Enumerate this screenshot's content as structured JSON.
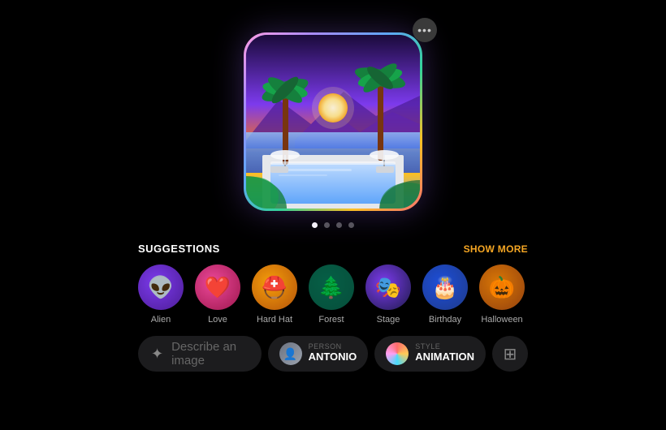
{
  "header": {
    "more_button_label": "•••"
  },
  "image": {
    "alt": "Tropical pool at sunset with palm trees"
  },
  "pagination": {
    "dots": [
      {
        "active": true
      },
      {
        "active": false
      },
      {
        "active": false
      },
      {
        "active": false
      }
    ]
  },
  "suggestions": {
    "title": "SUGGESTIONS",
    "show_more": "SHOW MORE",
    "items": [
      {
        "label": "Alien",
        "emoji": "👽",
        "bg_class": "alien-bg"
      },
      {
        "label": "Love",
        "emoji": "❤️",
        "bg_class": "love-bg"
      },
      {
        "label": "Hard Hat",
        "emoji": "⛑️",
        "bg_class": "hardhat-bg"
      },
      {
        "label": "Forest",
        "emoji": "🌲",
        "bg_class": "forest-bg"
      },
      {
        "label": "Stage",
        "emoji": "🎭",
        "bg_class": "stage-bg"
      },
      {
        "label": "Birthday",
        "emoji": "🎂",
        "bg_class": "birthday-bg"
      },
      {
        "label": "Halloween",
        "emoji": "🎃",
        "bg_class": "halloween-bg"
      }
    ]
  },
  "bottom_bar": {
    "describe_placeholder": "Describe an image",
    "person_label": "PERSON",
    "person_value": "ANTONIO",
    "style_label": "STYLE",
    "style_value": "ANIMATION"
  }
}
